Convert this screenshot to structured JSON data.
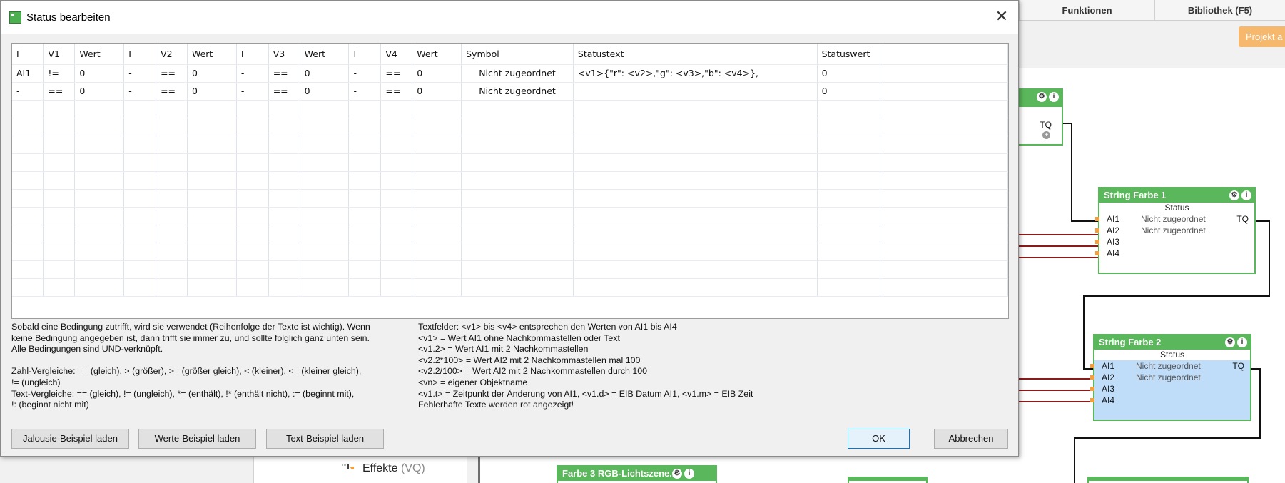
{
  "background": {
    "tabs": [
      {
        "label": "Funktionen"
      },
      {
        "label": "Bibliothek (F5)"
      }
    ],
    "projekt_button": "Projekt a",
    "tree_item": {
      "label": "Effekte",
      "suffix": "(VQ)"
    },
    "blocks": {
      "tq_block": {
        "out": "TQ"
      },
      "string_farbe_1": {
        "title": "String Farbe 1",
        "subtitle": "Status",
        "rows": [
          {
            "pin": "AI1",
            "value": "Nicht zugeordnet",
            "out": "TQ"
          },
          {
            "pin": "AI2",
            "value": "Nicht zugeordnet"
          },
          {
            "pin": "AI3"
          },
          {
            "pin": "AI4"
          }
        ]
      },
      "string_farbe_2": {
        "title": "String Farbe 2",
        "subtitle": "Status",
        "rows": [
          {
            "pin": "AI1",
            "value": "Nicht zugeordnet",
            "out": "TQ"
          },
          {
            "pin": "AI2",
            "value": "Nicht zugeordnet"
          },
          {
            "pin": "AI3"
          },
          {
            "pin": "AI4"
          }
        ]
      },
      "farbe3": {
        "title": "Farbe 3 RGB-Lichtszene..."
      }
    }
  },
  "dialog": {
    "title": "Status bearbeiten",
    "columns": [
      "I",
      "V1",
      "Wert",
      "I",
      "V2",
      "Wert",
      "I",
      "V3",
      "Wert",
      "I",
      "V4",
      "Wert",
      "Symbol",
      "Statustext",
      "Statuswert"
    ],
    "rows": [
      [
        "AI1",
        "!=",
        "0",
        "-",
        "==",
        "0",
        "-",
        "==",
        "0",
        "-",
        "==",
        "0",
        "Nicht zugeordnet",
        "<v1>{\"r\": <v2>,\"g\": <v3>,\"b\": <v4>},",
        "0"
      ],
      [
        "-",
        "==",
        "0",
        "-",
        "==",
        "0",
        "-",
        "==",
        "0",
        "-",
        "==",
        "0",
        "Nicht zugeordnet",
        "",
        "0"
      ]
    ],
    "help_left": [
      "Sobald eine Bedingung zutrifft, wird sie verwendet (Reihenfolge der Texte ist wichtig). Wenn",
      "keine Bedingung angegeben ist, dann trifft sie immer zu, und sollte folglich ganz unten sein.",
      "Alle Bedingungen sind UND-verknüpft.",
      "",
      "Zahl-Vergleiche: == (gleich), > (größer), >= (größer gleich), < (kleiner), <= (kleiner gleich),",
      "!= (ungleich)",
      "Text-Vergleiche: == (gleich), != (ungleich), *= (enthält), !* (enthält nicht), := (beginnt mit),",
      "!: (beginnt nicht mit)"
    ],
    "help_right": [
      "Textfelder: <v1> bis <v4> entsprechen den Werten von AI1 bis AI4",
      "<v1> = Wert AI1 ohne Nachkommastellen oder Text",
      "<v1.2> = Wert AI1 mit 2 Nachkommastellen",
      "<v2.2*100> = Wert AI2 mit 2 Nachkommastellen mal 100",
      "<v2.2/100> = Wert AI2 mit 2 Nachkommastellen durch 100",
      "<vn> = eigener Objektname",
      "<v1.t> = Zeitpunkt der Änderung von AI1, <v1.d> = EIB Datum AI1, <v1.m> = EIB Zeit",
      "Fehlerhafte Texte werden rot angezeigt!"
    ],
    "buttons": {
      "jalousie": "Jalousie-Beispiel laden",
      "werte": "Werte-Beispiel laden",
      "text": "Text-Beispiel laden",
      "ok": "OK",
      "cancel": "Abbrechen"
    }
  }
}
